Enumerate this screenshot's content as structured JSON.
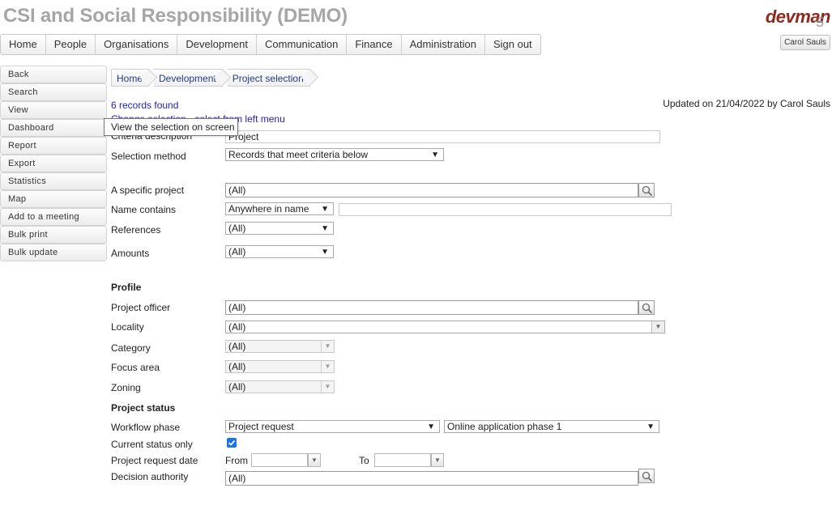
{
  "app": {
    "title": "CSI and Social Responsibility (DEMO)",
    "logo_text": "devman",
    "logo_num": "5",
    "user_button": "Carol Sauls"
  },
  "topnav": [
    {
      "label": "Home"
    },
    {
      "label": "People"
    },
    {
      "label": "Organisations"
    },
    {
      "label": "Development"
    },
    {
      "label": "Communication"
    },
    {
      "label": "Finance"
    },
    {
      "label": "Administration"
    },
    {
      "label": "Sign out"
    }
  ],
  "sidenav": [
    {
      "label": "Back"
    },
    {
      "label": "Search"
    },
    {
      "label": "View"
    },
    {
      "label": "Dashboard"
    },
    {
      "label": "Report"
    },
    {
      "label": "Export"
    },
    {
      "label": "Statistics"
    },
    {
      "label": "Map"
    },
    {
      "label": "Add to a meeting"
    },
    {
      "label": "Bulk print"
    },
    {
      "label": "Bulk update"
    }
  ],
  "breadcrumb": [
    {
      "label": "Home"
    },
    {
      "label": "Development"
    },
    {
      "label": "Project selection"
    }
  ],
  "records_found": "6 records found",
  "change_link": "Change selection - select from left menu",
  "updated": "Updated on 21/04/2022 by Carol Sauls",
  "tooltip": "View the selection on screen",
  "form": {
    "criteria_label": "Criteria description",
    "criteria_value": "Project",
    "selection_method_label": "Selection method",
    "selection_method_value": "Records that meet criteria below",
    "specific_project_label": "A specific project",
    "specific_project_value": "(All)",
    "name_contains_label": "Name contains",
    "name_contains_value": "Anywhere in name",
    "references_label": "References",
    "references_value": "(All)",
    "amounts_label": "Amounts",
    "amounts_value": "(All)",
    "profile_heading": "Profile",
    "project_officer_label": "Project officer",
    "project_officer_value": "(All)",
    "locality_label": "Locality",
    "locality_value": "(All)",
    "category_label": "Category",
    "category_value": "(All)",
    "focus_area_label": "Focus area",
    "focus_area_value": "(All)",
    "zoning_label": "Zoning",
    "zoning_value": "(All)",
    "status_heading": "Project status",
    "workflow_label": "Workflow phase",
    "workflow_value": "Project request",
    "workflow_sub_value": "Online application phase 1",
    "current_status_label": "Current status only",
    "current_status_checked": true,
    "request_date_label": "Project request date",
    "from_label": "From",
    "to_label": "To",
    "decision_label": "Decision authority",
    "decision_value": "(All)"
  }
}
